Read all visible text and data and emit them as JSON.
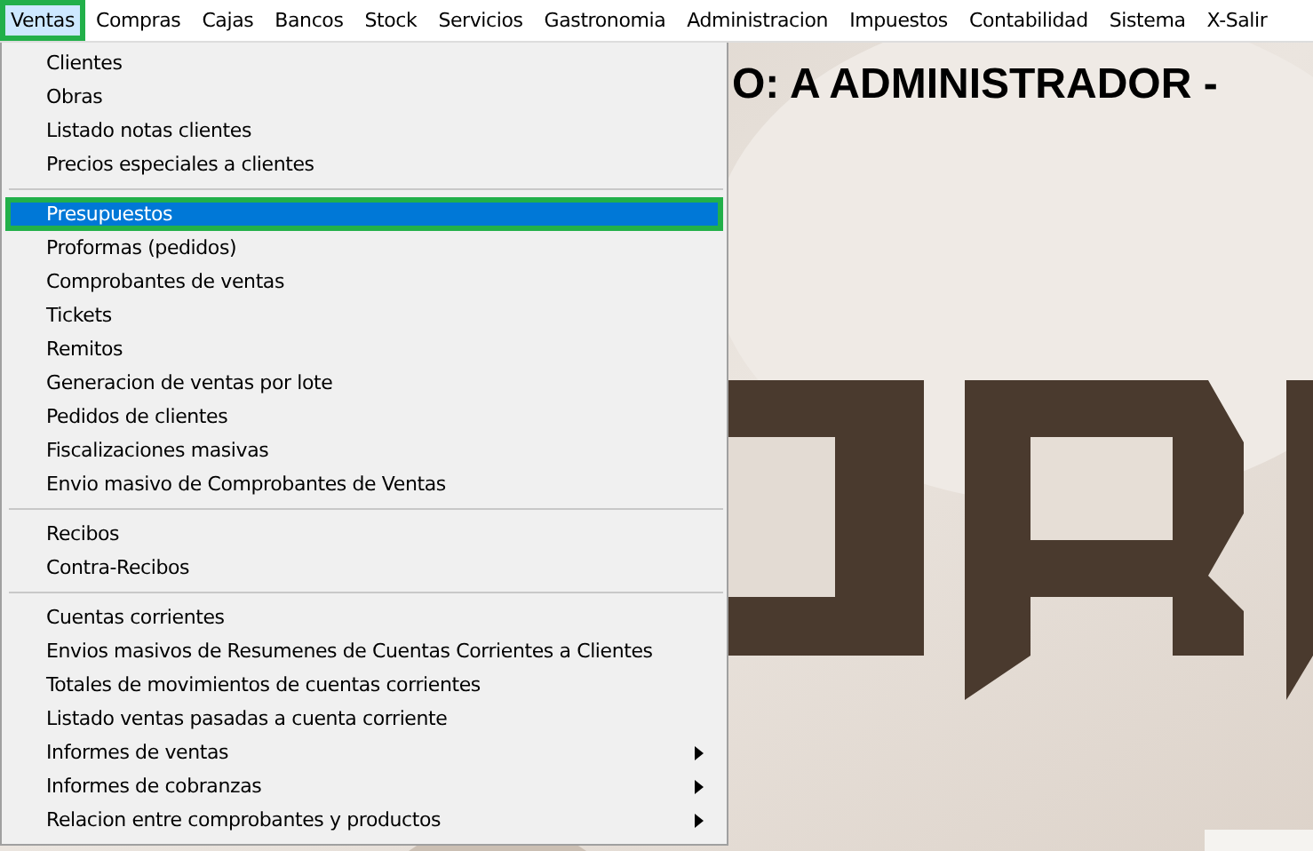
{
  "menubar": [
    {
      "label": "Ventas",
      "selected": true
    },
    {
      "label": "Compras",
      "selected": false
    },
    {
      "label": "Cajas",
      "selected": false
    },
    {
      "label": "Bancos",
      "selected": false
    },
    {
      "label": "Stock",
      "selected": false
    },
    {
      "label": "Servicios",
      "selected": false
    },
    {
      "label": "Gastronomia",
      "selected": false
    },
    {
      "label": "Administracion",
      "selected": false
    },
    {
      "label": "Impuestos",
      "selected": false
    },
    {
      "label": "Contabilidad",
      "selected": false
    },
    {
      "label": "Sistema",
      "selected": false
    },
    {
      "label": "X-Salir",
      "selected": false
    }
  ],
  "heading": "O: A ADMINISTRADOR -",
  "menu_sections": [
    {
      "items": [
        {
          "label": "Clientes",
          "selected": false,
          "has_submenu": false
        },
        {
          "label": "Obras",
          "selected": false,
          "has_submenu": false
        },
        {
          "label": "Listado notas clientes",
          "selected": false,
          "has_submenu": false
        },
        {
          "label": "Precios especiales a clientes",
          "selected": false,
          "has_submenu": false
        }
      ]
    },
    {
      "items": [
        {
          "label": "Presupuestos",
          "selected": true,
          "has_submenu": false
        },
        {
          "label": "Proformas (pedidos)",
          "selected": false,
          "has_submenu": false
        },
        {
          "label": "Comprobantes de ventas",
          "selected": false,
          "has_submenu": false
        },
        {
          "label": "Tickets",
          "selected": false,
          "has_submenu": false
        },
        {
          "label": "Remitos",
          "selected": false,
          "has_submenu": false
        },
        {
          "label": "Generacion de ventas por lote",
          "selected": false,
          "has_submenu": false
        },
        {
          "label": "Pedidos de clientes",
          "selected": false,
          "has_submenu": false
        },
        {
          "label": "Fiscalizaciones masivas",
          "selected": false,
          "has_submenu": false
        },
        {
          "label": "Envio masivo de Comprobantes de Ventas",
          "selected": false,
          "has_submenu": false
        }
      ]
    },
    {
      "items": [
        {
          "label": "Recibos",
          "selected": false,
          "has_submenu": false
        },
        {
          "label": "Contra-Recibos",
          "selected": false,
          "has_submenu": false
        }
      ]
    },
    {
      "items": [
        {
          "label": "Cuentas corrientes",
          "selected": false,
          "has_submenu": false
        },
        {
          "label": "Envios masivos de Resumenes de Cuentas Corrientes a Clientes",
          "selected": false,
          "has_submenu": false
        },
        {
          "label": "Totales de movimientos de cuentas corrientes",
          "selected": false,
          "has_submenu": false
        },
        {
          "label": "Listado ventas pasadas a cuenta corriente",
          "selected": false,
          "has_submenu": false
        },
        {
          "label": "Informes de ventas",
          "selected": false,
          "has_submenu": true
        },
        {
          "label": "Informes de cobranzas",
          "selected": false,
          "has_submenu": true
        },
        {
          "label": "Relacion entre comprobantes y productos",
          "selected": false,
          "has_submenu": true
        }
      ]
    }
  ]
}
